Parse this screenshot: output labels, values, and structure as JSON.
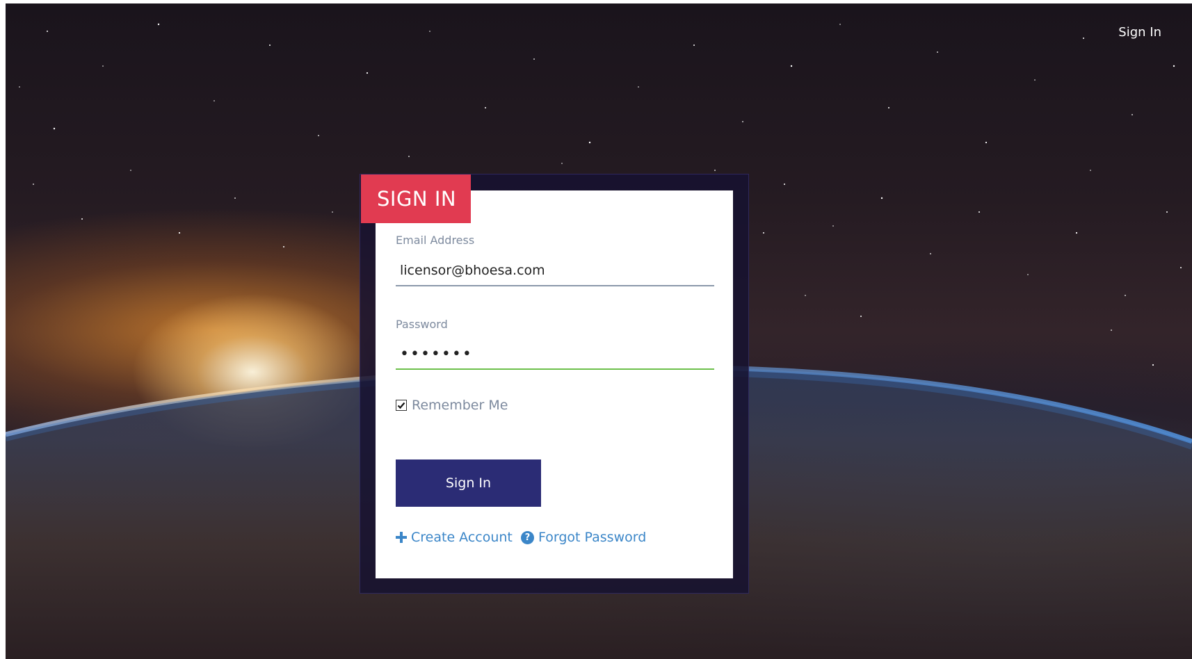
{
  "header": {
    "nav_signin_label": "Sign In"
  },
  "form": {
    "title": "SIGN IN",
    "email_label": "Email Address",
    "email_value": "licensor@bhoesa.com",
    "password_label": "Password",
    "password_value": "•••••••",
    "remember_label": "Remember Me",
    "remember_checked": true,
    "submit_label": "Sign In",
    "create_account_label": "Create Account",
    "forgot_password_label": "Forgot Password"
  },
  "colors": {
    "title_tab": "#e13b51",
    "submit_button": "#2b2c75",
    "link": "#3b86c8",
    "password_underline_active": "#6cc04a"
  },
  "icons": {
    "create_account": "plus-icon",
    "forgot_password": "question-circle-icon",
    "remember": "checkmark-icon"
  }
}
